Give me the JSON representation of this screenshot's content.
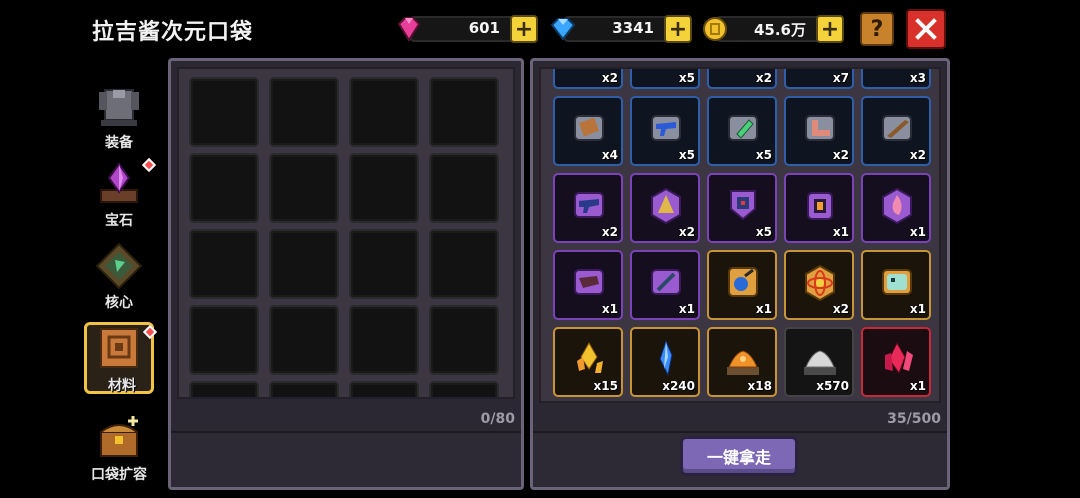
{
  "header": {
    "title": "拉吉酱次元口袋"
  },
  "currencies": [
    {
      "name": "pink-gem",
      "value": "601",
      "icon": "pink-gem-icon",
      "color": "#e8409a"
    },
    {
      "name": "blue-gem",
      "value": "3341",
      "icon": "blue-diamond-icon",
      "color": "#3aa6ff"
    },
    {
      "name": "gold-coin",
      "value": "45.6万",
      "icon": "gold-coin-icon",
      "color": "#f2c22e"
    }
  ],
  "buttons": {
    "help": "?",
    "plus": "+",
    "take_all": "一键拿走"
  },
  "sidebar": {
    "items": [
      {
        "label": "装备"
      },
      {
        "label": "宝石"
      },
      {
        "label": "核心"
      },
      {
        "label": "材料"
      },
      {
        "label": "口袋扩容"
      }
    ]
  },
  "left_panel": {
    "counter": "0/80"
  },
  "right_panel": {
    "counter": "35/500",
    "rows": [
      [
        {
          "q": "x2",
          "r": "blue"
        },
        {
          "q": "x5",
          "r": "blue"
        },
        {
          "q": "x2",
          "r": "blue"
        },
        {
          "q": "x7",
          "r": "blue"
        },
        {
          "q": "x3",
          "r": "blue"
        }
      ],
      [
        {
          "q": "x4",
          "r": "blue",
          "icon": "scroll-icon"
        },
        {
          "q": "x5",
          "r": "blue",
          "icon": "blue-gun-icon"
        },
        {
          "q": "x5",
          "r": "blue",
          "icon": "green-crystal-icon"
        },
        {
          "q": "x2",
          "r": "blue",
          "icon": "boomerang-icon"
        },
        {
          "q": "x2",
          "r": "blue",
          "icon": "rifle-icon"
        }
      ],
      [
        {
          "q": "x2",
          "r": "purple",
          "icon": "purple-blaster-icon"
        },
        {
          "q": "x2",
          "r": "purple",
          "icon": "golden-bell-icon"
        },
        {
          "q": "x5",
          "r": "purple",
          "icon": "shield-icon"
        },
        {
          "q": "x1",
          "r": "purple",
          "icon": "amulet-icon"
        },
        {
          "q": "x1",
          "r": "purple",
          "icon": "pink-flame-icon"
        }
      ],
      [
        {
          "q": "x1",
          "r": "purple",
          "icon": "bow-icon"
        },
        {
          "q": "x1",
          "r": "purple",
          "icon": "staff-icon"
        },
        {
          "q": "x1",
          "r": "gold",
          "icon": "blue-orb-icon"
        },
        {
          "q": "x2",
          "r": "gold",
          "icon": "atom-icon"
        },
        {
          "q": "x1",
          "r": "gold",
          "icon": "skull-fish-icon"
        }
      ],
      [
        {
          "q": "x15",
          "r": "gold",
          "icon": "gold-shard-icon"
        },
        {
          "q": "x240",
          "r": "gold",
          "icon": "blue-shard-icon"
        },
        {
          "q": "x18",
          "r": "gold",
          "icon": "orange-ore-icon"
        },
        {
          "q": "x570",
          "r": "dark",
          "icon": "white-ore-icon"
        },
        {
          "q": "x1",
          "r": "red",
          "icon": "red-crystal-icon"
        }
      ]
    ]
  }
}
